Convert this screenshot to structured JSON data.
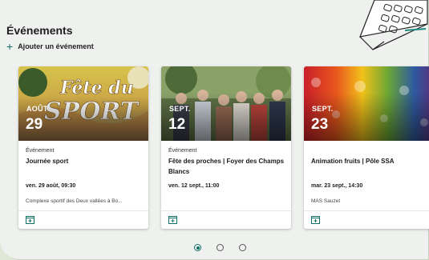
{
  "section": {
    "title": "Événements",
    "add_label": "Ajouter un événement"
  },
  "events": [
    {
      "month": "AOÛT",
      "day": "29",
      "type": "Événement",
      "name": "Journée sport",
      "when": "ven. 29 août, 09:30",
      "location": "Complexe sportif des Deux vallées à Bo...",
      "image_text": "Fête du SPORT"
    },
    {
      "month": "SEPT.",
      "day": "12",
      "type": "Événement",
      "name": "Fête des proches | Foyer des Champs Blancs",
      "when": "ven. 12 sept., 11:00",
      "location": ""
    },
    {
      "month": "SEPT.",
      "day": "23",
      "type": "",
      "name": "Animation fruits | Pôle SSA",
      "when": "mar. 23 sept., 14:30",
      "location": "MAS Sauzet"
    }
  ],
  "pagination": {
    "pages": 3,
    "current": 1
  },
  "colors": {
    "accent": "#0f6e66",
    "background": "#eff1ef",
    "outer": "#dfe8d6"
  },
  "icons": {
    "add": "plus-icon",
    "calendar": "calendar-add-icon",
    "decor": "calendar-sketch-icon"
  }
}
